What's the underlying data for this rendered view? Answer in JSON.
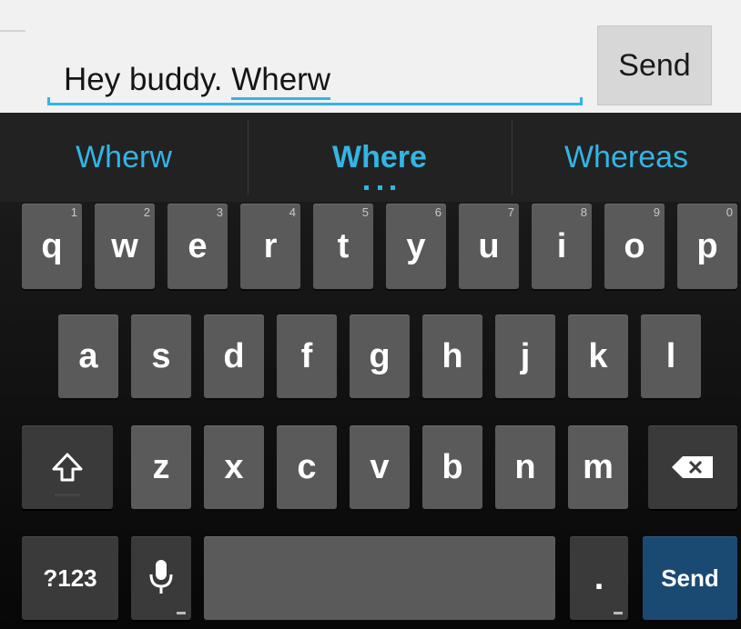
{
  "compose": {
    "typed_text": "Hey buddy. ",
    "typed_word": "Wherw",
    "send_label": "Send"
  },
  "suggestions": [
    "Wherw",
    "Where",
    "Whereas"
  ],
  "keyboard": {
    "row1": [
      {
        "label": "q",
        "hint": "1"
      },
      {
        "label": "w",
        "hint": "2"
      },
      {
        "label": "e",
        "hint": "3"
      },
      {
        "label": "r",
        "hint": "4"
      },
      {
        "label": "t",
        "hint": "5"
      },
      {
        "label": "y",
        "hint": "6"
      },
      {
        "label": "u",
        "hint": "7"
      },
      {
        "label": "i",
        "hint": "8"
      },
      {
        "label": "o",
        "hint": "9"
      },
      {
        "label": "p",
        "hint": "0"
      }
    ],
    "row2": [
      "a",
      "s",
      "d",
      "f",
      "g",
      "h",
      "j",
      "k",
      "l"
    ],
    "row3": [
      "z",
      "x",
      "c",
      "v",
      "b",
      "n",
      "m"
    ],
    "shift_icon": "shift-arrow-icon",
    "backspace_icon": "backspace-icon",
    "symbols_label": "?123",
    "mic_icon": "microphone-icon",
    "period_label": ".",
    "send_label": "Send"
  },
  "colors": {
    "accent": "#33b5e5",
    "key": "#5a5a5a",
    "action_key": "#1a4a72"
  }
}
